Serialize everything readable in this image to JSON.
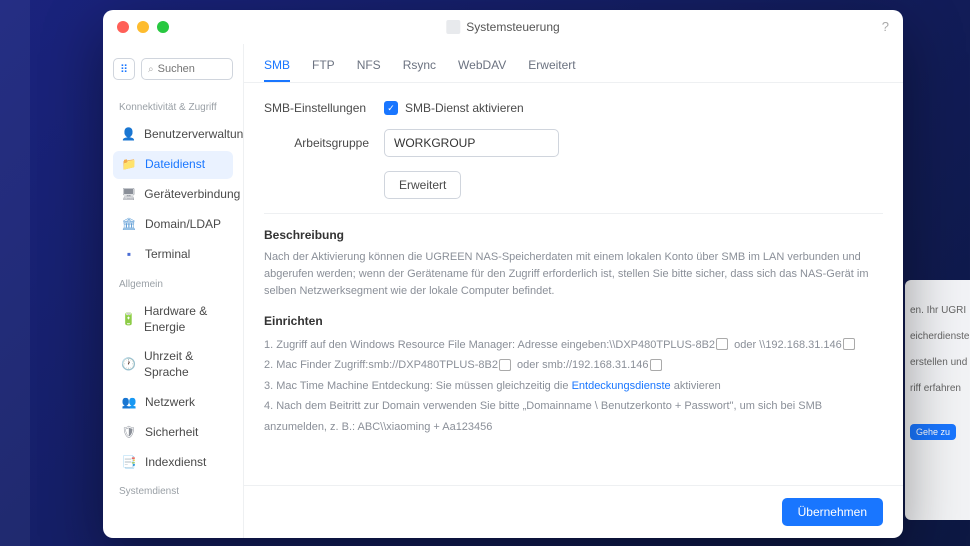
{
  "window": {
    "title": "Systemsteuerung"
  },
  "search": {
    "placeholder": "Suchen"
  },
  "sidebar": {
    "section1_title": "Konnektivität & Zugriff",
    "section2_title": "Allgemein",
    "section3_title": "Systemdienst",
    "items": [
      {
        "label": "Benutzerverwaltung"
      },
      {
        "label": "Dateidienst"
      },
      {
        "label": "Geräteverbindung"
      },
      {
        "label": "Domain/LDAP"
      },
      {
        "label": "Terminal"
      },
      {
        "label": "Hardware & Energie"
      },
      {
        "label": "Uhrzeit & Sprache"
      },
      {
        "label": "Netzwerk"
      },
      {
        "label": "Sicherheit"
      },
      {
        "label": "Indexdienst"
      }
    ]
  },
  "tabs": {
    "items": [
      {
        "label": "SMB"
      },
      {
        "label": "FTP"
      },
      {
        "label": "NFS"
      },
      {
        "label": "Rsync"
      },
      {
        "label": "WebDAV"
      },
      {
        "label": "Erweitert"
      }
    ]
  },
  "form": {
    "settings_label": "SMB-Einstellungen",
    "checkbox_label": "SMB-Dienst aktivieren",
    "workgroup_label": "Arbeitsgruppe",
    "workgroup_value": "WORKGROUP",
    "advanced_btn": "Erweitert"
  },
  "description": {
    "title": "Beschreibung",
    "text": "Nach der Aktivierung können die UGREEN NAS-Speicherdaten mit einem lokalen Konto über SMB im LAN verbunden und abgerufen werden; wenn der Gerätename für den Zugriff erforderlich ist, stellen Sie bitte sicher, dass sich das NAS-Gerät im selben Netzwerksegment wie der lokale Computer befindet."
  },
  "setup": {
    "title": "Einrichten",
    "line1_a": "1. Zugriff auf den Windows Resource File Manager: Adresse eingeben:\\\\DXP480TPLUS-8B2",
    "line1_b": "oder",
    "line1_c": "\\\\192.168.31.146",
    "line2_a": "2. Mac Finder Zugriff:smb://DXP480TPLUS-8B2",
    "line2_b": "oder",
    "line2_c": "smb://192.168.31.146",
    "line3_a": "3. Mac Time Machine Entdeckung: Sie müssen gleichzeitig die",
    "line3_link": "Entdeckungsdienste",
    "line3_b": "aktivieren",
    "line4": "4. Nach dem Beitritt zur Domain verwenden Sie bitte „Domainname \\ Benutzerkonto + Passwort\", um sich bei SMB anzumelden, z. B.: ABC\\\\xiaoming + Aa123456"
  },
  "footer": {
    "apply_btn": "Übernehmen"
  },
  "background": {
    "text1": "en. Ihr UGRI",
    "text2": "eicherdienste",
    "text3": "erstellen und",
    "text4": "riff erfahren",
    "btn": "Gehe zu"
  }
}
